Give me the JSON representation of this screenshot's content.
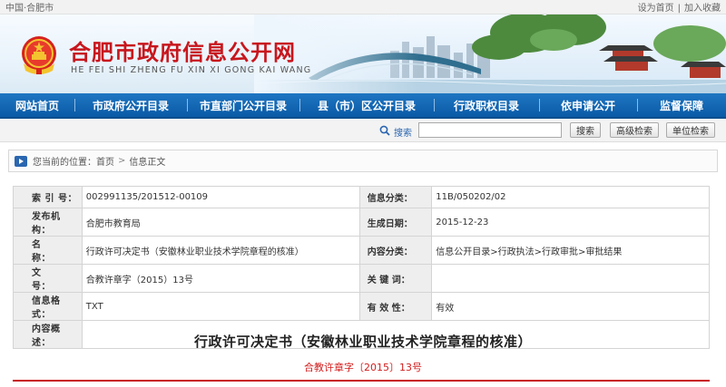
{
  "topbar": {
    "left": "中国·合肥市",
    "set_home": "设为首页",
    "separator": "|",
    "favorite": "加入收藏"
  },
  "header": {
    "title_cn": "合肥市政府信息公开网",
    "title_en": "HE FEI SHI ZHENG FU XIN XI GONG KAI WANG"
  },
  "nav": {
    "items": [
      "网站首页",
      "市政府公开目录",
      "市直部门公开目录",
      "县（市）区公开目录",
      "行政职权目录",
      "依申请公开",
      "监督保障"
    ]
  },
  "search": {
    "label": "搜索",
    "input_value": "",
    "search_button": "搜索",
    "advanced_button": "高级检索",
    "unit_button": "单位检索"
  },
  "breadcrumb": {
    "prefix": "您当前的位置：",
    "home": "首页",
    "arrow": ">",
    "current": "信息正文"
  },
  "info": {
    "index_label": "索 引 号：",
    "index_value": "002991135/201512-00109",
    "category_label": "信息分类：",
    "category_value": "11B/050202/02",
    "publisher_label": "发布机构：",
    "publisher_value": "合肥市教育局",
    "date_label": "生成日期：",
    "date_value": "2015-12-23",
    "name_label": "名　　称：",
    "name_value": "行政许可决定书（安徽林业职业技术学院章程的核准）",
    "content_cat_label": "内容分类：",
    "content_cat_value": "信息公开目录>行政执法>行政审批>审批结果",
    "docno_label": "文　　号：",
    "docno_value": "合教许章字（2015）13号",
    "keywords_label": "关 键 词：",
    "keywords_value": "",
    "format_label": "信息格式：",
    "format_value": "TXT",
    "validity_label": "有 效 性：",
    "validity_value": "有效",
    "summary_label": "内容概述：",
    "summary_value": ""
  },
  "document": {
    "title": "行政许可决定书（安徽林业职业技术学院章程的核准）",
    "number": "合教许章字〔2015〕13号"
  },
  "colors": {
    "nav_blue": "#0a5aa6",
    "title_red": "#c8161d",
    "docno_red": "#d21c1c"
  }
}
